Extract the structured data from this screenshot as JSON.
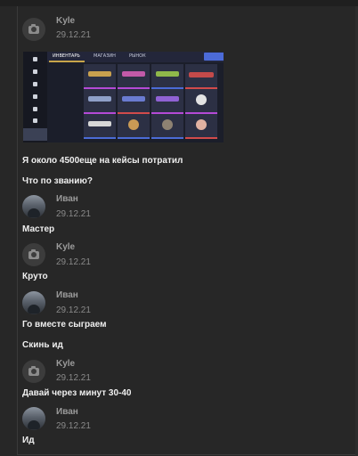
{
  "messages": [
    {
      "author": "Kyle",
      "date": "29.12.21",
      "avatar": "camera-placeholder",
      "attachment": "game-inventory-screenshot"
    },
    {
      "text": "Я около 4500еще на кейсы потратил"
    },
    {
      "text": "Что по званию?"
    },
    {
      "author": "Иван",
      "date": "29.12.21",
      "avatar": "photo"
    },
    {
      "text": "Мастер"
    },
    {
      "author": "Kyle",
      "date": "29.12.21",
      "avatar": "camera-placeholder"
    },
    {
      "text": "Круто"
    },
    {
      "author": "Иван",
      "date": "29.12.21",
      "avatar": "photo"
    },
    {
      "text": "Го вместе сыграем"
    },
    {
      "text": "Скинь ид"
    },
    {
      "author": "Kyle",
      "date": "29.12.21",
      "avatar": "camera-placeholder"
    },
    {
      "text": "Давай через минут 30-40"
    },
    {
      "author": "Иван",
      "date": "29.12.21",
      "avatar": "photo"
    },
    {
      "text": "Ид"
    }
  ],
  "screenshot": {
    "tabs": [
      "ИНВЕНТАРЬ",
      "МАГАЗИН",
      "РЫНОК"
    ],
    "colors": {
      "background": "#1b1e2a",
      "accent": "#c7a54a",
      "rarity": "#7d4bd6"
    }
  }
}
